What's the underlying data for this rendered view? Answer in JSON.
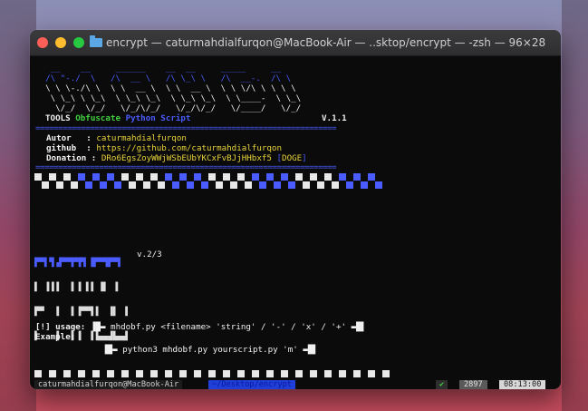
{
  "window": {
    "title": "encrypt — caturmahdialfurqon@MacBook-Air — ..sktop/encrypt — -zsh — 96×28"
  },
  "banner": {
    "lines": [
      "   __    __     ______    __  __     _____     __",
      "  /\\ \"-./  \\   /\\  __ \\   /\\ \\_\\ \\   /\\  __-.  /\\ \\",
      "  \\ \\ \\-./\\ \\  \\ \\  __ \\  \\ \\  __ \\  \\ \\ \\/\\ \\ \\ \\ \\",
      "   \\ \\_\\ \\ \\_\\  \\ \\_\\ \\_\\  \\ \\_\\ \\_\\  \\ \\____-  \\ \\_\\",
      "    \\/_/  \\/_/   \\/_/\\/_/   \\/_/\\/_/   \\/____/   \\/_/"
    ],
    "tools": "TOOLS",
    "obfuscate": "Obfuscate",
    "python_script": "Python Script",
    "version": "V.1.1"
  },
  "separator": "==================================================================",
  "info": {
    "author_label": "Autor   : ",
    "author_value": "caturmahdialfurqon",
    "github_label": "github  : ",
    "github_value": "https://github.com/caturmahdialfurqon",
    "donation_label": "Donation : ",
    "donation_value": "DRo6EgsZoyWWjWSbEUbYKCxFvBJjHHbxf5",
    "donation_tag_open": "[",
    "donation_tag": "DOGE",
    "donation_tag_close": "]"
  },
  "python_logo": {
    "lines": [
      "▛▀▌▜▗▛▀▜▀▛▌▐▛▀▜▛▀▌",
      "▌ ▐▐▐  ▐ ▌▐▐ ▐▌ ▐",
      "▛▀  ▐  ▐ ▛▀▜▐  ▐▌ ▐",
      "▌   ▐  ▐ ▌ ▐▐▄▄▟▙▄▟"
    ],
    "version": "v.2/3"
  },
  "usage": {
    "prefix": "[!] usage:",
    "command": "mhdobf.py <filename> 'string' / '-' / 'x' / '+'",
    "example_label": "Example:",
    "example_command": "python3 mhdobf.py yourscript.py 'm'"
  },
  "prompt": {
    "user": "caturmahdialfurqon@MacBook-Air",
    "path": "~/Desktop/encrypt",
    "status_ok": "✔",
    "history_number": "2897",
    "time": "08:13:00"
  },
  "colors": {
    "accent_blue": "#4b5cff",
    "accent_green": "#3fcf3f",
    "accent_yellow": "#e7d23a",
    "terminal_bg": "#0b0b0b"
  }
}
